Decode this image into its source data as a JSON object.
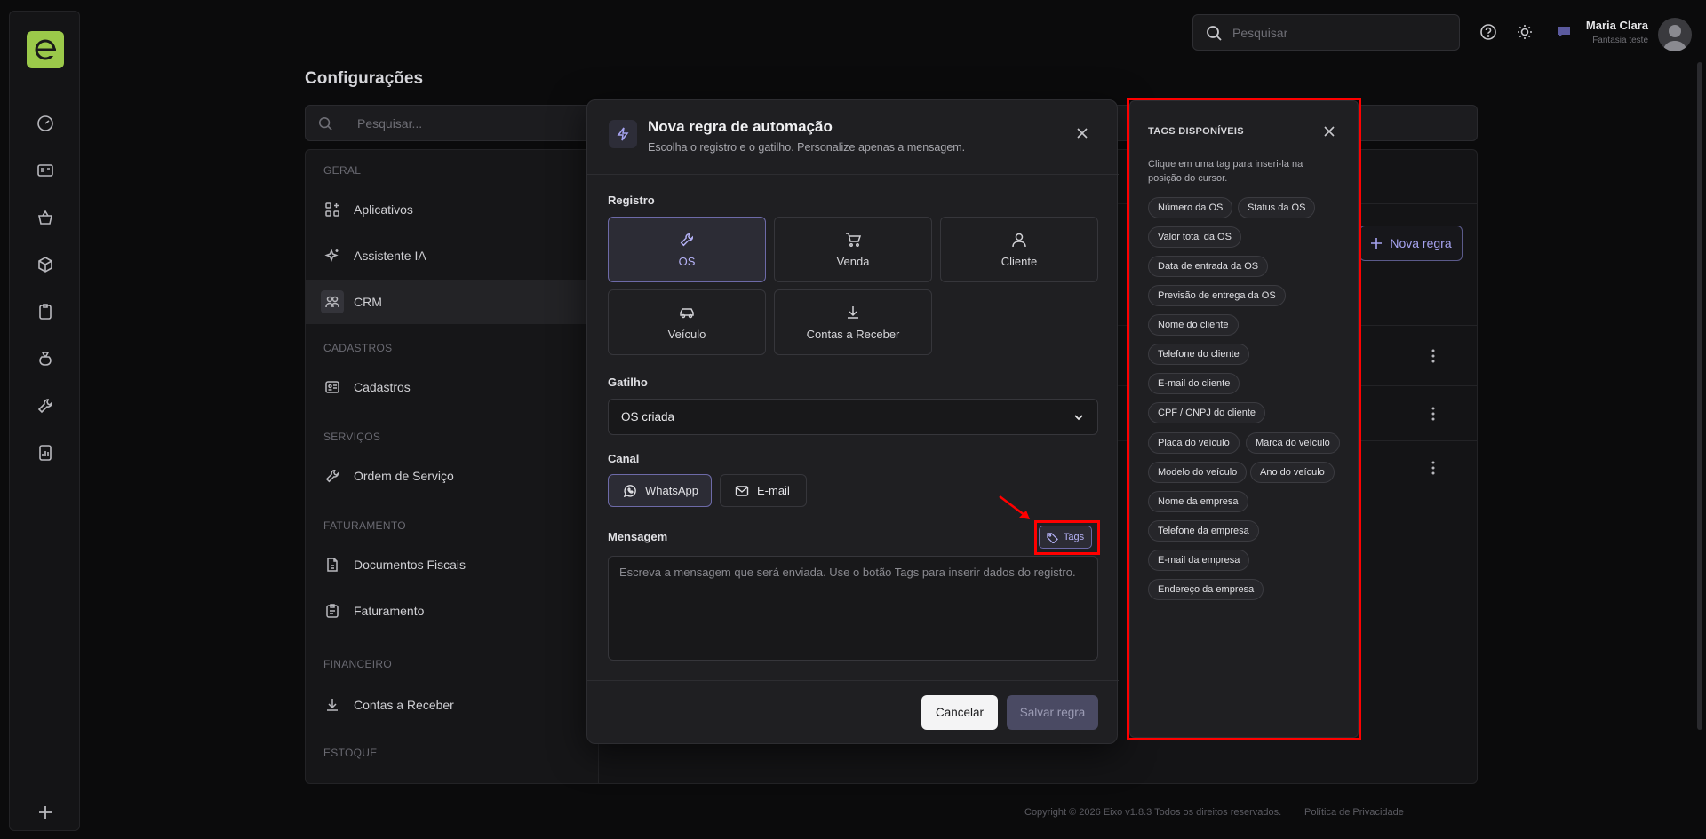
{
  "topbar": {
    "search_placeholder": "Pesquisar",
    "user_name": "Maria Clara",
    "user_company": "Fantasia teste"
  },
  "page": {
    "title": "Configurações",
    "search_placeholder": "Pesquisar..."
  },
  "settings_nav": {
    "sections": [
      {
        "label": "GERAL"
      },
      {
        "label": "CADASTROS"
      },
      {
        "label": "SERVIÇOS"
      },
      {
        "label": "FATURAMENTO"
      },
      {
        "label": "FINANCEIRO"
      },
      {
        "label": "ESTOQUE"
      }
    ],
    "items": [
      {
        "label": "Aplicativos",
        "icon": "apps-icon"
      },
      {
        "label": "Assistente IA",
        "icon": "sparkles-icon"
      },
      {
        "label": "CRM",
        "icon": "users-icon"
      },
      {
        "label": "Cadastros",
        "icon": "id-card-icon"
      },
      {
        "label": "Ordem de Serviço",
        "icon": "wrench-icon"
      },
      {
        "label": "Documentos Fiscais",
        "icon": "file-icon"
      },
      {
        "label": "Faturamento",
        "icon": "clipboard-icon"
      },
      {
        "label": "Contas a Receber",
        "icon": "download-icon"
      }
    ]
  },
  "main": {
    "new_rule_label": "Nova regra"
  },
  "modal": {
    "title": "Nova regra de automação",
    "subtitle": "Escolha o registro e o gatilho. Personalize apenas a mensagem.",
    "registro_label": "Registro",
    "registros": [
      {
        "label": "OS",
        "icon": "wrench-icon",
        "selected": true
      },
      {
        "label": "Venda",
        "icon": "cart-icon",
        "selected": false
      },
      {
        "label": "Cliente",
        "icon": "user-icon",
        "selected": false
      },
      {
        "label": "Veículo",
        "icon": "car-icon",
        "selected": false
      },
      {
        "label": "Contas a Receber",
        "icon": "download-icon",
        "selected": false
      }
    ],
    "gatilho_label": "Gatilho",
    "gatilho_value": "OS criada",
    "canal_label": "Canal",
    "canais": [
      {
        "label": "WhatsApp",
        "icon": "whatsapp-icon",
        "selected": true
      },
      {
        "label": "E-mail",
        "icon": "mail-icon",
        "selected": false
      }
    ],
    "mensagem_label": "Mensagem",
    "tags_button": "Tags",
    "message_placeholder": "Escreva a mensagem que será enviada. Use o botão Tags para inserir dados do registro.",
    "cancel": "Cancelar",
    "save": "Salvar regra"
  },
  "tags_panel": {
    "title": "TAGS DISPONÍVEIS",
    "description": "Clique em uma tag para inseri-la na posição do cursor.",
    "tags": [
      "Número da OS",
      "Status da OS",
      "Valor total da OS",
      "Data de entrada da OS",
      "Previsão de entrega da OS",
      "Nome do cliente",
      "Telefone do cliente",
      "E-mail do cliente",
      "CPF / CNPJ do cliente",
      "Placa do veículo",
      "Marca do veículo",
      "Modelo do veículo",
      "Ano do veículo",
      "Nome da empresa",
      "Telefone da empresa",
      "E-mail da empresa",
      "Endereço da empresa"
    ]
  },
  "footer": {
    "copyright": "Copyright © 2026 Eixo v1.8.3 Todos os direitos reservados.",
    "privacy": "Política de Privacidade"
  },
  "colors": {
    "accent": "#a6a3f0",
    "brand": "#9bc94a",
    "highlight": "#ff0000"
  }
}
